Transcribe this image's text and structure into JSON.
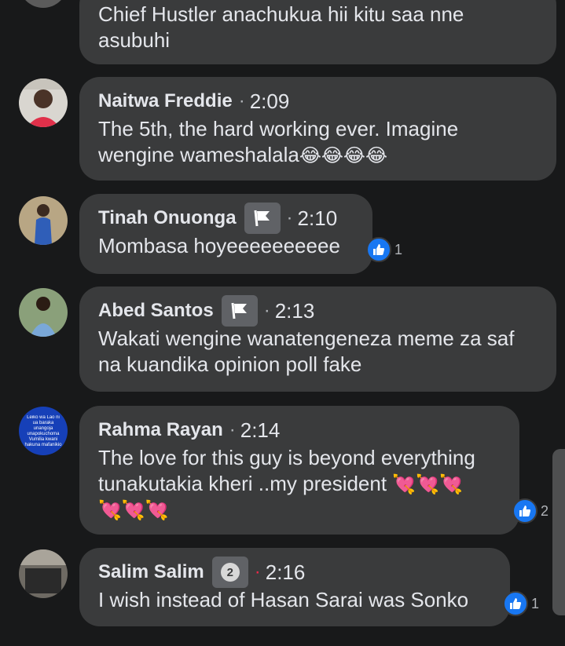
{
  "comments": [
    {
      "id": "c0",
      "text": "Chief Hustler anachukua hii kitu saa nne asubuhi"
    },
    {
      "id": "c1",
      "name": "Naitwa Freddie",
      "time": "2:09",
      "text": "The 5th, the hard working ever. Imagine wengine wameshalala",
      "emoji": "😂😂😂😂"
    },
    {
      "id": "c2",
      "name": "Tinah Onuonga",
      "badge": "flag-icon",
      "time": "2:10",
      "text": "Mombasa hoyeeeeeeeeee",
      "reactions": "1"
    },
    {
      "id": "c3",
      "name": "Abed Santos",
      "badge": "flag-icon",
      "time": "2:13",
      "text": "Wakati wengine wanatengeneza meme za saf na kuandika opinion poll fake"
    },
    {
      "id": "c4",
      "name": "Rahma Rayan",
      "time": "2:14",
      "text_line1": "The love for this guy is beyond everything",
      "text_line2": "tunakutakia kheri ..my president",
      "emoji1": "💘💘💘",
      "emoji2": "💘💘💘",
      "reactions": "2",
      "avatar_text": "Leiko wa Lao ni ua baraka unangoja unapokuchoma Vumilia kwani hakuna mafanikio kila wakati"
    },
    {
      "id": "c5",
      "name": "Salim Salim",
      "badge_number": "2",
      "time": "2:16",
      "text": "I wish instead of Hasan Sarai was Sonko",
      "reactions": "1"
    }
  ],
  "colors": {
    "bubble": "#3a3b3c",
    "background": "#18191a",
    "like": "#1877f2",
    "new_dot": "#f02849"
  }
}
